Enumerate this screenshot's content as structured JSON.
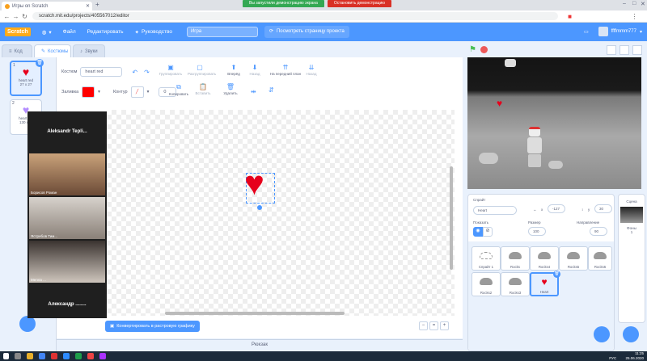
{
  "browser": {
    "tab_title": "Игры on Scratch",
    "url": "scratch.mit.edu/projects/405567012/editor",
    "share_notice": "Вы запустили демонстрацию экрана",
    "share_stop": "Остановить демонстрацию"
  },
  "menubar": {
    "logo": "Scratch",
    "file": "Файл",
    "edit": "Редактировать",
    "tutorials": "Руководство",
    "project_title": "Игра",
    "see_project": "Посмотреть страницу проекта",
    "username": "ffffmmm777"
  },
  "tabs": {
    "code": "Код",
    "costumes": "Костюмы",
    "sounds": "Звуки"
  },
  "costumes": [
    {
      "num": "1",
      "name": "heart red",
      "size": "27 x 27",
      "color": "#e6001c"
    },
    {
      "num": "2",
      "name": "heart p...",
      "size": "130 x ...",
      "color": "#b38dff"
    }
  ],
  "paint": {
    "costume_label": "Костюм",
    "costume_name": "heart red",
    "fill_label": "Заливка",
    "fill_color": "#ff0000",
    "outline_label": "Контур",
    "outline_width": "0",
    "group": "Группировать",
    "ungroup": "Разгруппировать",
    "forward": "Вперёд",
    "backward": "Назад",
    "front": "На передний план",
    "back": "Назад",
    "copy": "Копировать",
    "paste": "Вставить",
    "delete": "Удалить",
    "convert": "Конвертировать в растровую графику",
    "backpack": "Рюкзак"
  },
  "call": {
    "host": "Aleksandr Tepli...",
    "participants": [
      "Борисов Роман",
      "Ястребов Тим...",
      "Мелла ..."
    ],
    "footer": "Александр ........"
  },
  "sprite_info": {
    "sprite_label": "Спрайт",
    "sprite_name": "Heart",
    "x_label": "x",
    "x": "-127",
    "y_label": "y",
    "y": "30",
    "show_label": "Показать",
    "size_label": "Размер",
    "size": "100",
    "direction_label": "Направление",
    "direction": "90"
  },
  "sprites": [
    "Спрайт 1",
    "Rocks",
    "Rocks4",
    "Rocks5",
    "Rocks6",
    "Rocks2",
    "Rocks3",
    "Heart"
  ],
  "stage_pane": {
    "title": "Сцена",
    "backdrops_label": "Фоны",
    "backdrops": "1"
  },
  "taskbar": {
    "lang": "РУС",
    "time": "11:25",
    "date": "25.06.2020"
  }
}
